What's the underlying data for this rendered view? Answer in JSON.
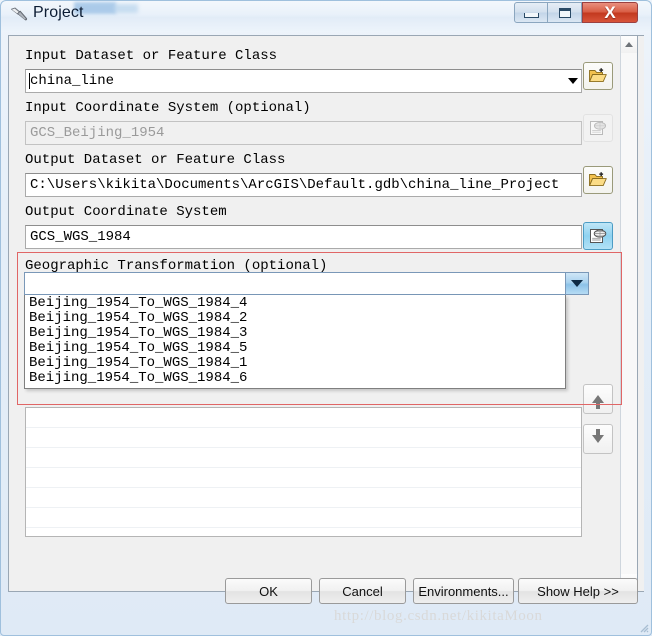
{
  "window": {
    "title": "Project",
    "app_icon": "hammer-tool-icon",
    "controls": {
      "minimize": "minimize-icon",
      "maximize": "maximize-icon",
      "close": "X"
    }
  },
  "fields": {
    "input_dataset": {
      "label": "Input Dataset or Feature Class",
      "value": "china_line",
      "browse_icon": "open-folder-icon"
    },
    "input_coordinate_system": {
      "label": "Input Coordinate System (optional)",
      "value": "GCS_Beijing_1954",
      "disabled": true,
      "browse_icon": "coordinate-system-icon"
    },
    "output_dataset": {
      "label": "Output Dataset or Feature Class",
      "value": "C:\\Users\\kikita\\Documents\\ArcGIS\\Default.gdb\\china_line_Project",
      "browse_icon": "open-folder-icon"
    },
    "output_coordinate_system": {
      "label": "Output Coordinate System",
      "value": "GCS_WGS_1984",
      "browse_icon": "coordinate-system-icon"
    },
    "geographic_transformation": {
      "label": "Geographic Transformation (optional)",
      "value": "",
      "dropdown_open": true,
      "options": [
        "Beijing_1954_To_WGS_1984_4",
        "Beijing_1954_To_WGS_1984_2",
        "Beijing_1954_To_WGS_1984_3",
        "Beijing_1954_To_WGS_1984_5",
        "Beijing_1954_To_WGS_1984_1",
        "Beijing_1954_To_WGS_1984_6"
      ]
    }
  },
  "list_controls": {
    "move_up": "arrow-up-icon",
    "move_down": "arrow-down-icon"
  },
  "buttons": {
    "ok": "OK",
    "cancel": "Cancel",
    "environments": "Environments...",
    "show_help": "Show Help >>"
  },
  "watermark": "http://blog.csdn.net/kikitaMoon",
  "colors": {
    "highlight_box": "#e06666",
    "close_button": "#c3391f",
    "active_icon_bg": "#8fd2f0"
  }
}
